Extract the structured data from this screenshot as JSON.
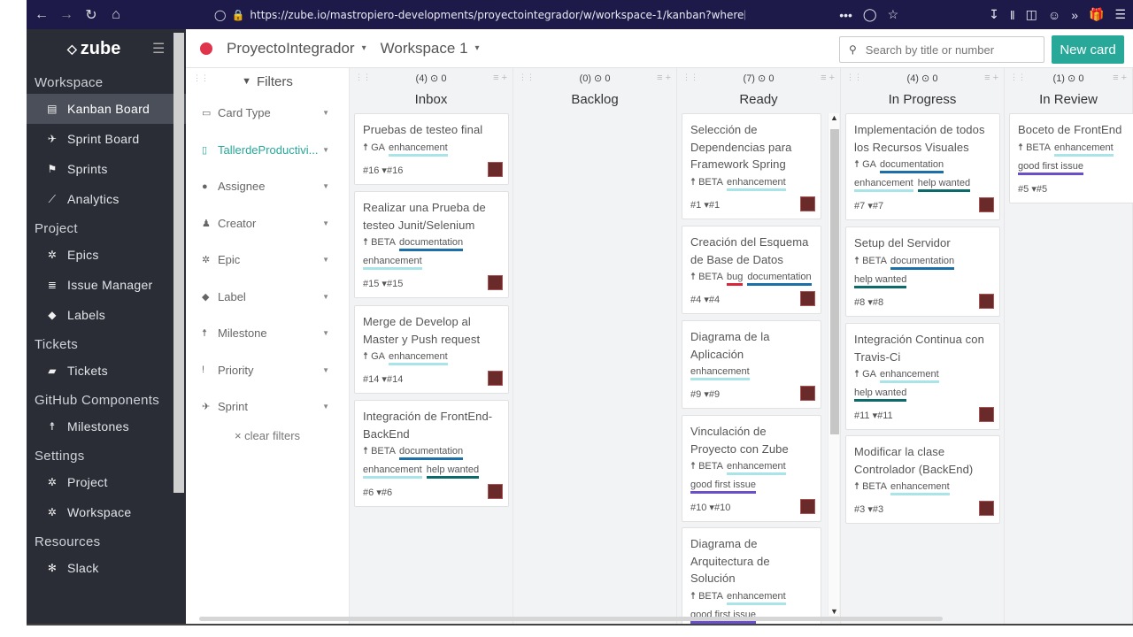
{
  "browser": {
    "url": "https://zube.io/mastropiero-developments/proyectointegrador/w/workspace-1/kanban?where[source_ids][]",
    "more": "•••"
  },
  "sidebar": {
    "brand": "zube",
    "sections": [
      {
        "label": "Workspace",
        "items": [
          {
            "label": "Kanban Board",
            "icon": "kanban-icon",
            "active": true
          },
          {
            "label": "Sprint Board",
            "icon": "sprint-board-icon"
          },
          {
            "label": "Sprints",
            "icon": "flag-icon"
          },
          {
            "label": "Analytics",
            "icon": "chart-icon"
          }
        ]
      },
      {
        "label": "Project",
        "items": [
          {
            "label": "Epics",
            "icon": "epic-icon"
          },
          {
            "label": "Issue Manager",
            "icon": "list-icon"
          },
          {
            "label": "Labels",
            "icon": "tag-icon"
          }
        ]
      },
      {
        "label": "Tickets",
        "items": [
          {
            "label": "Tickets",
            "icon": "ticket-icon"
          }
        ]
      },
      {
        "label": "GitHub Components",
        "items": [
          {
            "label": "Milestones",
            "icon": "milestone-icon"
          }
        ]
      },
      {
        "label": "Settings",
        "items": [
          {
            "label": "Project",
            "icon": "gear-icon"
          },
          {
            "label": "Workspace",
            "icon": "gear-icon"
          }
        ]
      },
      {
        "label": "Resources",
        "items": [
          {
            "label": "Slack",
            "icon": "slack-icon"
          }
        ]
      }
    ]
  },
  "header": {
    "project": "ProyectoIntegrador",
    "workspace": "Workspace 1",
    "search_placeholder": "Search by title or number",
    "new_card": "New card"
  },
  "filters": {
    "title": "Filters",
    "items": [
      {
        "label": "Card Type",
        "icon": "card-type-icon"
      },
      {
        "label": "TallerdeProductivi...",
        "icon": "repo-icon",
        "highlight": true
      },
      {
        "label": "Assignee",
        "icon": "user-icon"
      },
      {
        "label": "Creator",
        "icon": "creator-icon"
      },
      {
        "label": "Epic",
        "icon": "epic-icon"
      },
      {
        "label": "Label",
        "icon": "tag-icon"
      },
      {
        "label": "Milestone",
        "icon": "milestone-icon"
      },
      {
        "label": "Priority",
        "icon": "priority-icon"
      },
      {
        "label": "Sprint",
        "icon": "sprint-icon"
      }
    ],
    "clear": "clear filters"
  },
  "columns": [
    {
      "name": "Inbox",
      "count": "(4)",
      "points": "0",
      "cards": [
        {
          "title": "Pruebas de testeo final",
          "milestone": "GA",
          "labels": [
            [
              "enhancement",
              "enh"
            ]
          ],
          "num": "#16",
          "ref": "#16"
        },
        {
          "title": "Realizar una Prueba de testeo Junit/Selenium",
          "milestone": "BETA",
          "labels": [
            [
              "documentation",
              "doc"
            ],
            [
              "enhancement",
              "enh"
            ]
          ],
          "num": "#15",
          "ref": "#15"
        },
        {
          "title": "Merge de Develop al Master y Push request",
          "milestone": "GA",
          "labels": [
            [
              "enhancement",
              "enh"
            ]
          ],
          "num": "#14",
          "ref": "#14"
        },
        {
          "title": "Integración de FrontEnd-BackEnd",
          "milestone": "BETA",
          "labels": [
            [
              "documentation",
              "doc"
            ],
            [
              "enhancement",
              "enh"
            ],
            [
              "help wanted",
              "help"
            ]
          ],
          "num": "#6",
          "ref": "#6"
        }
      ]
    },
    {
      "name": "Backlog",
      "count": "(0)",
      "points": "0",
      "cards": []
    },
    {
      "name": "Ready",
      "count": "(7)",
      "points": "0",
      "cards": [
        {
          "title": "Selección de Dependencias para Framework Spring",
          "milestone": "BETA",
          "labels": [
            [
              "enhancement",
              "enh"
            ]
          ],
          "num": "#1",
          "ref": "#1"
        },
        {
          "title": "Creación del Esquema de Base de Datos",
          "milestone": "BETA",
          "labels": [
            [
              "bug",
              "bug"
            ],
            [
              "documentation",
              "doc"
            ]
          ],
          "num": "#4",
          "ref": "#4"
        },
        {
          "title": "Diagrama de la Aplicación",
          "milestone": "",
          "labels": [
            [
              "enhancement",
              "enh"
            ]
          ],
          "num": "#9",
          "ref": "#9"
        },
        {
          "title": "Vinculación de Proyecto con Zube",
          "milestone": "BETA",
          "labels": [
            [
              "enhancement",
              "enh"
            ],
            [
              "good first issue",
              "good"
            ]
          ],
          "num": "#10",
          "ref": "#10"
        },
        {
          "title": "Diagrama de Arquitectura de Solución",
          "milestone": "BETA",
          "labels": [
            [
              "enhancement",
              "enh"
            ],
            [
              "good first issue",
              "good"
            ]
          ],
          "num": "",
          "ref": ""
        }
      ]
    },
    {
      "name": "In Progress",
      "count": "(4)",
      "points": "0",
      "cards": [
        {
          "title": "Implementación de todos los Recursos Visuales",
          "milestone": "GA",
          "labels": [
            [
              "documentation",
              "doc"
            ],
            [
              "enhancement",
              "enh"
            ],
            [
              "help wanted",
              "help"
            ]
          ],
          "num": "#7",
          "ref": "#7"
        },
        {
          "title": "Setup del Servidor",
          "milestone": "BETA",
          "labels": [
            [
              "documentation",
              "doc"
            ],
            [
              "help wanted",
              "help"
            ]
          ],
          "num": "#8",
          "ref": "#8"
        },
        {
          "title": "Integración Continua con Travis-Ci",
          "milestone": "GA",
          "labels": [
            [
              "enhancement",
              "enh"
            ],
            [
              "help wanted",
              "help"
            ]
          ],
          "num": "#11",
          "ref": "#11"
        },
        {
          "title": "Modificar la clase Controlador (BackEnd)",
          "milestone": "BETA",
          "labels": [
            [
              "enhancement",
              "enh"
            ]
          ],
          "num": "#3",
          "ref": "#3"
        }
      ]
    },
    {
      "name": "In Review",
      "count": "(1)",
      "points": "0",
      "cards": [
        {
          "title": "Boceto de FrontEnd",
          "milestone": "BETA",
          "labels": [
            [
              "enhancement",
              "enh"
            ],
            [
              "good first issue",
              "good"
            ]
          ],
          "num": "#5",
          "ref": "#5"
        }
      ]
    }
  ]
}
